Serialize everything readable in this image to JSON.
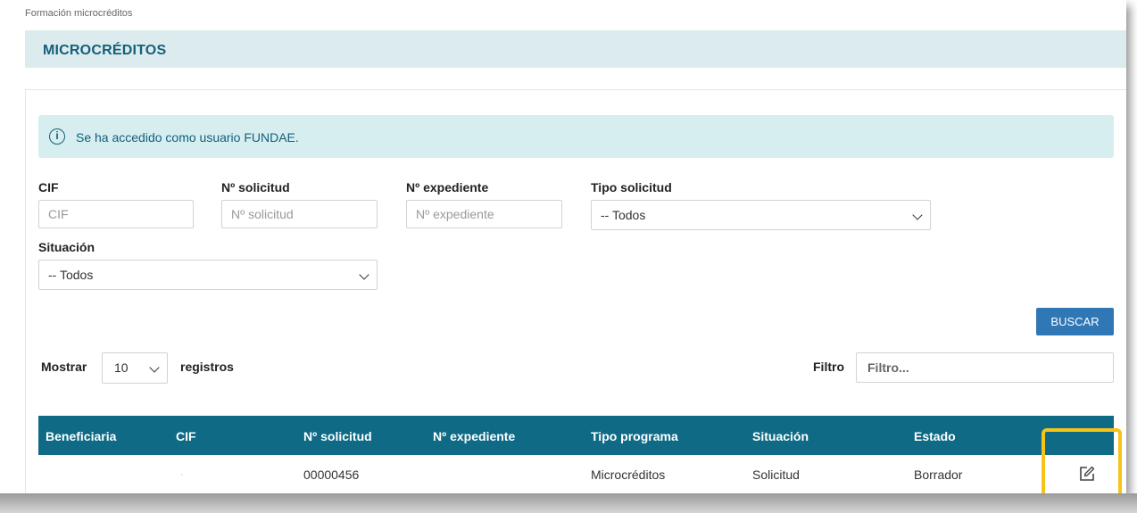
{
  "breadcrumb": "Formación microcréditos",
  "page_title": "MICROCRÉDITOS",
  "alert": {
    "icon": "info-icon",
    "text": "Se ha accedido como usuario FUNDAE."
  },
  "filters": {
    "cif": {
      "label": "CIF",
      "placeholder": "CIF"
    },
    "n_solicitud": {
      "label": "Nº solicitud",
      "placeholder": "Nº solicitud"
    },
    "n_expediente": {
      "label": "Nº expediente",
      "placeholder": "Nº expediente"
    },
    "tipo_solicitud": {
      "label": "Tipo solicitud",
      "value": "-- Todos"
    },
    "situacion": {
      "label": "Situación",
      "value": "-- Todos"
    }
  },
  "buscar_label": "BUSCAR",
  "show": {
    "prefix": "Mostrar",
    "value": "10",
    "suffix": "registros"
  },
  "filter": {
    "label": "Filtro",
    "placeholder": "Filtro..."
  },
  "table": {
    "headers": [
      "Beneficiaria",
      "CIF",
      "Nº solicitud",
      "Nº expediente",
      "Tipo programa",
      "Situación",
      "Estado"
    ],
    "rows": [
      {
        "beneficiaria": "",
        "cif": "-",
        "n_solicitud": "00000456",
        "n_expediente": "",
        "tipo_programa": "Microcréditos",
        "situacion": "Solicitud",
        "estado": "Borrador",
        "action_icon": "edit-icon"
      }
    ]
  },
  "colors": {
    "accent": "#0f6a85",
    "button": "#2f77b5",
    "highlight": "#f6c318",
    "title_bg": "#dcecee",
    "alert_bg": "#d6eef0"
  }
}
